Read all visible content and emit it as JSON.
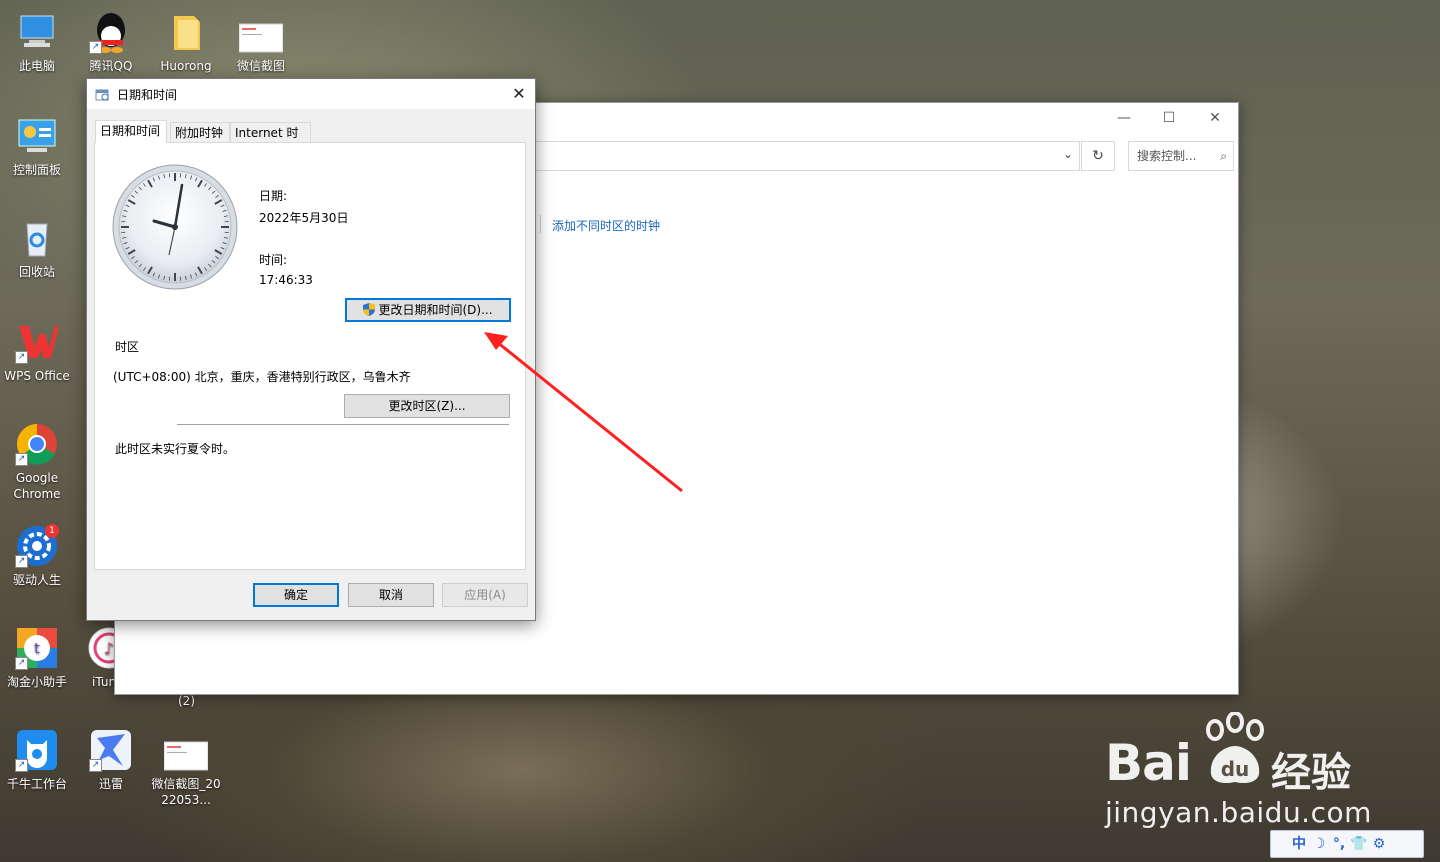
{
  "desktop": {
    "icons": [
      {
        "label": "此电脑",
        "icon": "computer-icon"
      },
      {
        "label": "腾讯QQ",
        "icon": "qq-icon"
      },
      {
        "label": "Huorong",
        "icon": "folder-icon"
      },
      {
        "label": "微信截图",
        "icon": "screenshot-thumb-icon"
      },
      {
        "label": "控制面板",
        "icon": "control-panel-icon"
      },
      {
        "label": "回收站",
        "icon": "recycle-bin-icon"
      },
      {
        "label": "WPS Office",
        "icon": "wps-icon"
      },
      {
        "label": "Google Chrome",
        "icon": "chrome-icon"
      },
      {
        "label": "驱动人生",
        "icon": "driver-life-icon",
        "badge": "1"
      },
      {
        "label": "淘金小助手",
        "icon": "taojin-icon"
      },
      {
        "label": "iTun",
        "icon": "itunes-icon"
      },
      {
        "label": "千牛工作台",
        "icon": "qianniu-icon"
      },
      {
        "label": "迅雷",
        "icon": "xunlei-icon"
      },
      {
        "label": "微信截图_2022053...",
        "icon": "screenshot-thumb-icon"
      }
    ],
    "partial_text": "(2)"
  },
  "explorer": {
    "search_placeholder": "搜索控制...",
    "link": "添加不同时区的时钟"
  },
  "dialog": {
    "title": "日期和时间",
    "tabs": [
      "日期和时间",
      "附加时钟",
      "Internet 时间"
    ],
    "date_label": "日期:",
    "date_value": "2022年5月30日",
    "time_label": "时间:",
    "time_value": "17:46:33",
    "change_datetime_button": "更改日期和时间(D)...",
    "timezone_heading": "时区",
    "timezone_value": "(UTC+08:00) 北京，重庆，香港特别行政区，乌鲁木齐",
    "change_timezone_button": "更改时区(Z)...",
    "dst_note": "此时区未实行夏令时。",
    "ok_button": "确定",
    "cancel_button": "取消",
    "apply_button": "应用(A)"
  },
  "watermark": {
    "brand": "Bai",
    "brand_suffix": "经验",
    "url": "jingyan.baidu.com"
  },
  "tray": [
    "中",
    "☽",
    "°,",
    "👕",
    "⚙"
  ],
  "colors": {
    "accent": "#0078d7",
    "link": "#1a66c0",
    "annotation_arrow": "#ff2020"
  }
}
